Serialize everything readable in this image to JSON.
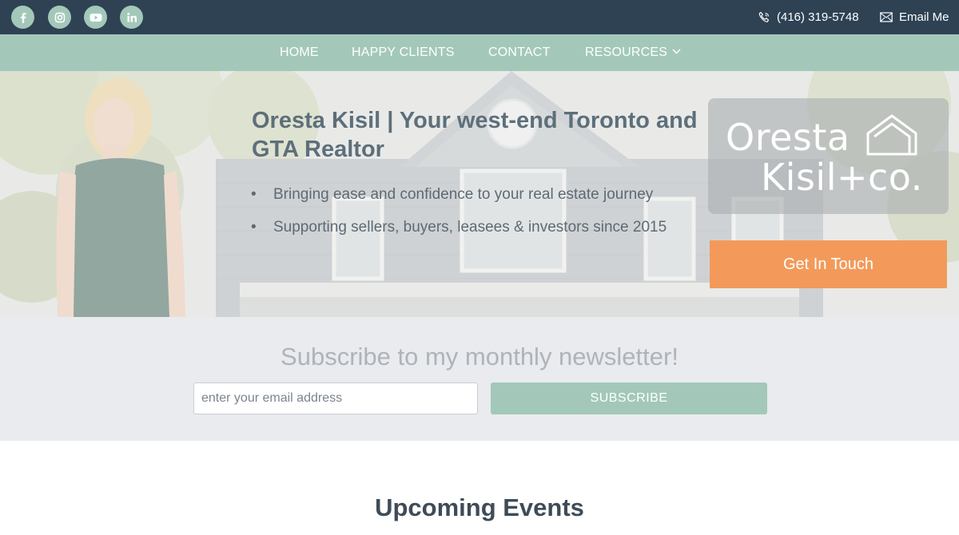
{
  "topbar": {
    "social": [
      {
        "name": "facebook-icon"
      },
      {
        "name": "instagram-icon"
      },
      {
        "name": "youtube-icon"
      },
      {
        "name": "linkedin-icon"
      }
    ],
    "phone": "(416) 319-5748",
    "email_label": "Email Me"
  },
  "nav": {
    "items": [
      "HOME",
      "HAPPY CLIENTS",
      "CONTACT",
      "RESOURCES"
    ]
  },
  "hero": {
    "headline": "Oresta Kisil | Your west-end Toronto and GTA Realtor",
    "bullets": [
      "Bringing ease and confidence to your real estate journey",
      "Supporting sellers, buyers, leasees & investors since 2015"
    ],
    "logo_line1": "Oresta",
    "logo_line2": "Kisil+co.",
    "cta_label": "Get In Touch"
  },
  "newsletter": {
    "title": "Subscribe to my monthly newsletter!",
    "placeholder": "enter your email address",
    "value": "",
    "button_label": "SUBSCRIBE"
  },
  "events": {
    "title": "Upcoming Events"
  },
  "colors": {
    "topbar": "#2e4254",
    "accent_green": "#a3c8b9",
    "cta_orange": "#f39a5a",
    "newsletter_bg": "#e9ebee"
  }
}
